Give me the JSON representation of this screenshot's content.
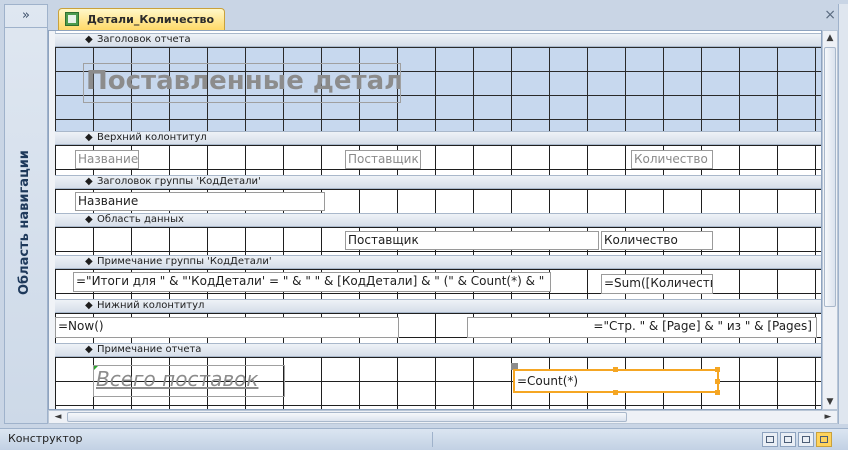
{
  "nav": {
    "toggle": "»",
    "label": "Область навигации"
  },
  "tab": {
    "title": "Детали_Количество",
    "close": "×"
  },
  "sections": {
    "report_header": "Заголовок отчета",
    "page_header": "Верхний колонтитул",
    "group_header": "Заголовок группы 'КодДетали'",
    "detail": "Область данных",
    "group_footer": "Примечание группы 'КодДетали'",
    "page_footer": "Нижний колонтитул",
    "report_footer": "Примечание отчета"
  },
  "section_marker": "◆",
  "controls": {
    "title": "Поставленные детали",
    "hdr_name": "Название",
    "hdr_supplier": "Поставщик",
    "hdr_qty": "Количество",
    "grp_name": "Название",
    "det_supplier": "Поставщик",
    "det_qty": "Количество",
    "grp_total_expr": "=\"Итоги для \" & \"'КодДетали' = \" & \" \" & [КодДетали] & \" (\" & Count(*) & \" ",
    "grp_sum_expr": "=Sum([Количество])",
    "now_expr": "=Now()",
    "page_expr": "=\"Стр. \" & [Page] & \" из \" & [Pages]",
    "total_label": "Всего поставок",
    "count_expr": "=Count(*)"
  },
  "scroll": {
    "up": "▲",
    "down": "▼",
    "left": "◄",
    "right": "►"
  },
  "status": {
    "mode": "Конструктор"
  },
  "colors": {
    "band_blue": "#c7d8ee",
    "selection": "#f5a623",
    "tab_active": "#ffd968"
  }
}
